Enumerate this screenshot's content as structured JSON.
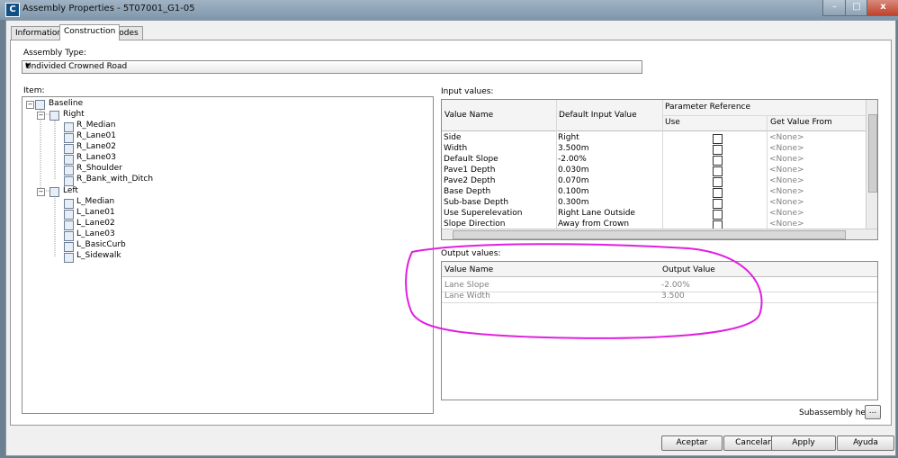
{
  "window": {
    "title": "Assembly Properties - 5T07001_G1-05",
    "app_icon": "C"
  },
  "tabs": [
    {
      "label": "Information"
    },
    {
      "label": "Construction"
    },
    {
      "label": "Codes"
    }
  ],
  "assembly_type": {
    "label": "Assembly Type:",
    "value": "Undivided Crowned Road"
  },
  "item": {
    "label": "Item:",
    "root": "Baseline",
    "groups": [
      {
        "label": "Right",
        "children": [
          "R_Median",
          "R_Lane01",
          "R_Lane02",
          "R_Lane03",
          "R_Shoulder",
          "R_Bank_with_Ditch"
        ]
      },
      {
        "label": "Left",
        "children": [
          "L_Median",
          "L_Lane01",
          "L_Lane02",
          "L_Lane03",
          "L_BasicCurb",
          "L_Sidewalk"
        ]
      }
    ]
  },
  "input_values": {
    "label": "Input values:",
    "headers": {
      "name": "Value Name",
      "default": "Default Input Value",
      "param_ref": "Parameter Reference",
      "use": "Use",
      "get_from": "Get Value From"
    },
    "rows": [
      {
        "name": "Side",
        "value": "Right",
        "from": "<None>"
      },
      {
        "name": "Width",
        "value": "3.500m",
        "from": "<None>"
      },
      {
        "name": "Default Slope",
        "value": "-2.00%",
        "from": "<None>"
      },
      {
        "name": "Pave1 Depth",
        "value": "0.030m",
        "from": "<None>"
      },
      {
        "name": "Pave2 Depth",
        "value": "0.070m",
        "from": "<None>"
      },
      {
        "name": "Base Depth",
        "value": "0.100m",
        "from": "<None>"
      },
      {
        "name": "Sub-base Depth",
        "value": "0.300m",
        "from": "<None>"
      },
      {
        "name": "Use Superelevation",
        "value": "Right Lane Outside",
        "from": "<None>"
      },
      {
        "name": "Slope Direction",
        "value": "Away from Crown",
        "from": "<None>"
      }
    ]
  },
  "output_values": {
    "label": "Output values:",
    "headers": {
      "name": "Value Name",
      "value": "Output Value"
    },
    "rows": [
      {
        "name": "Lane Slope",
        "value": "-2.00%"
      },
      {
        "name": "Lane Width",
        "value": "3.500"
      }
    ]
  },
  "subassembly_help": {
    "label": "Subassembly help:",
    "button": "..."
  },
  "buttons": {
    "accept": "Aceptar",
    "cancel": "Cancelar",
    "apply": "Apply",
    "help": "Ayuda"
  },
  "titlebar_controls": {
    "minimize": "–",
    "maximize": "□",
    "close": "x"
  },
  "colors": {
    "highlight_circle": "#e020e0"
  }
}
